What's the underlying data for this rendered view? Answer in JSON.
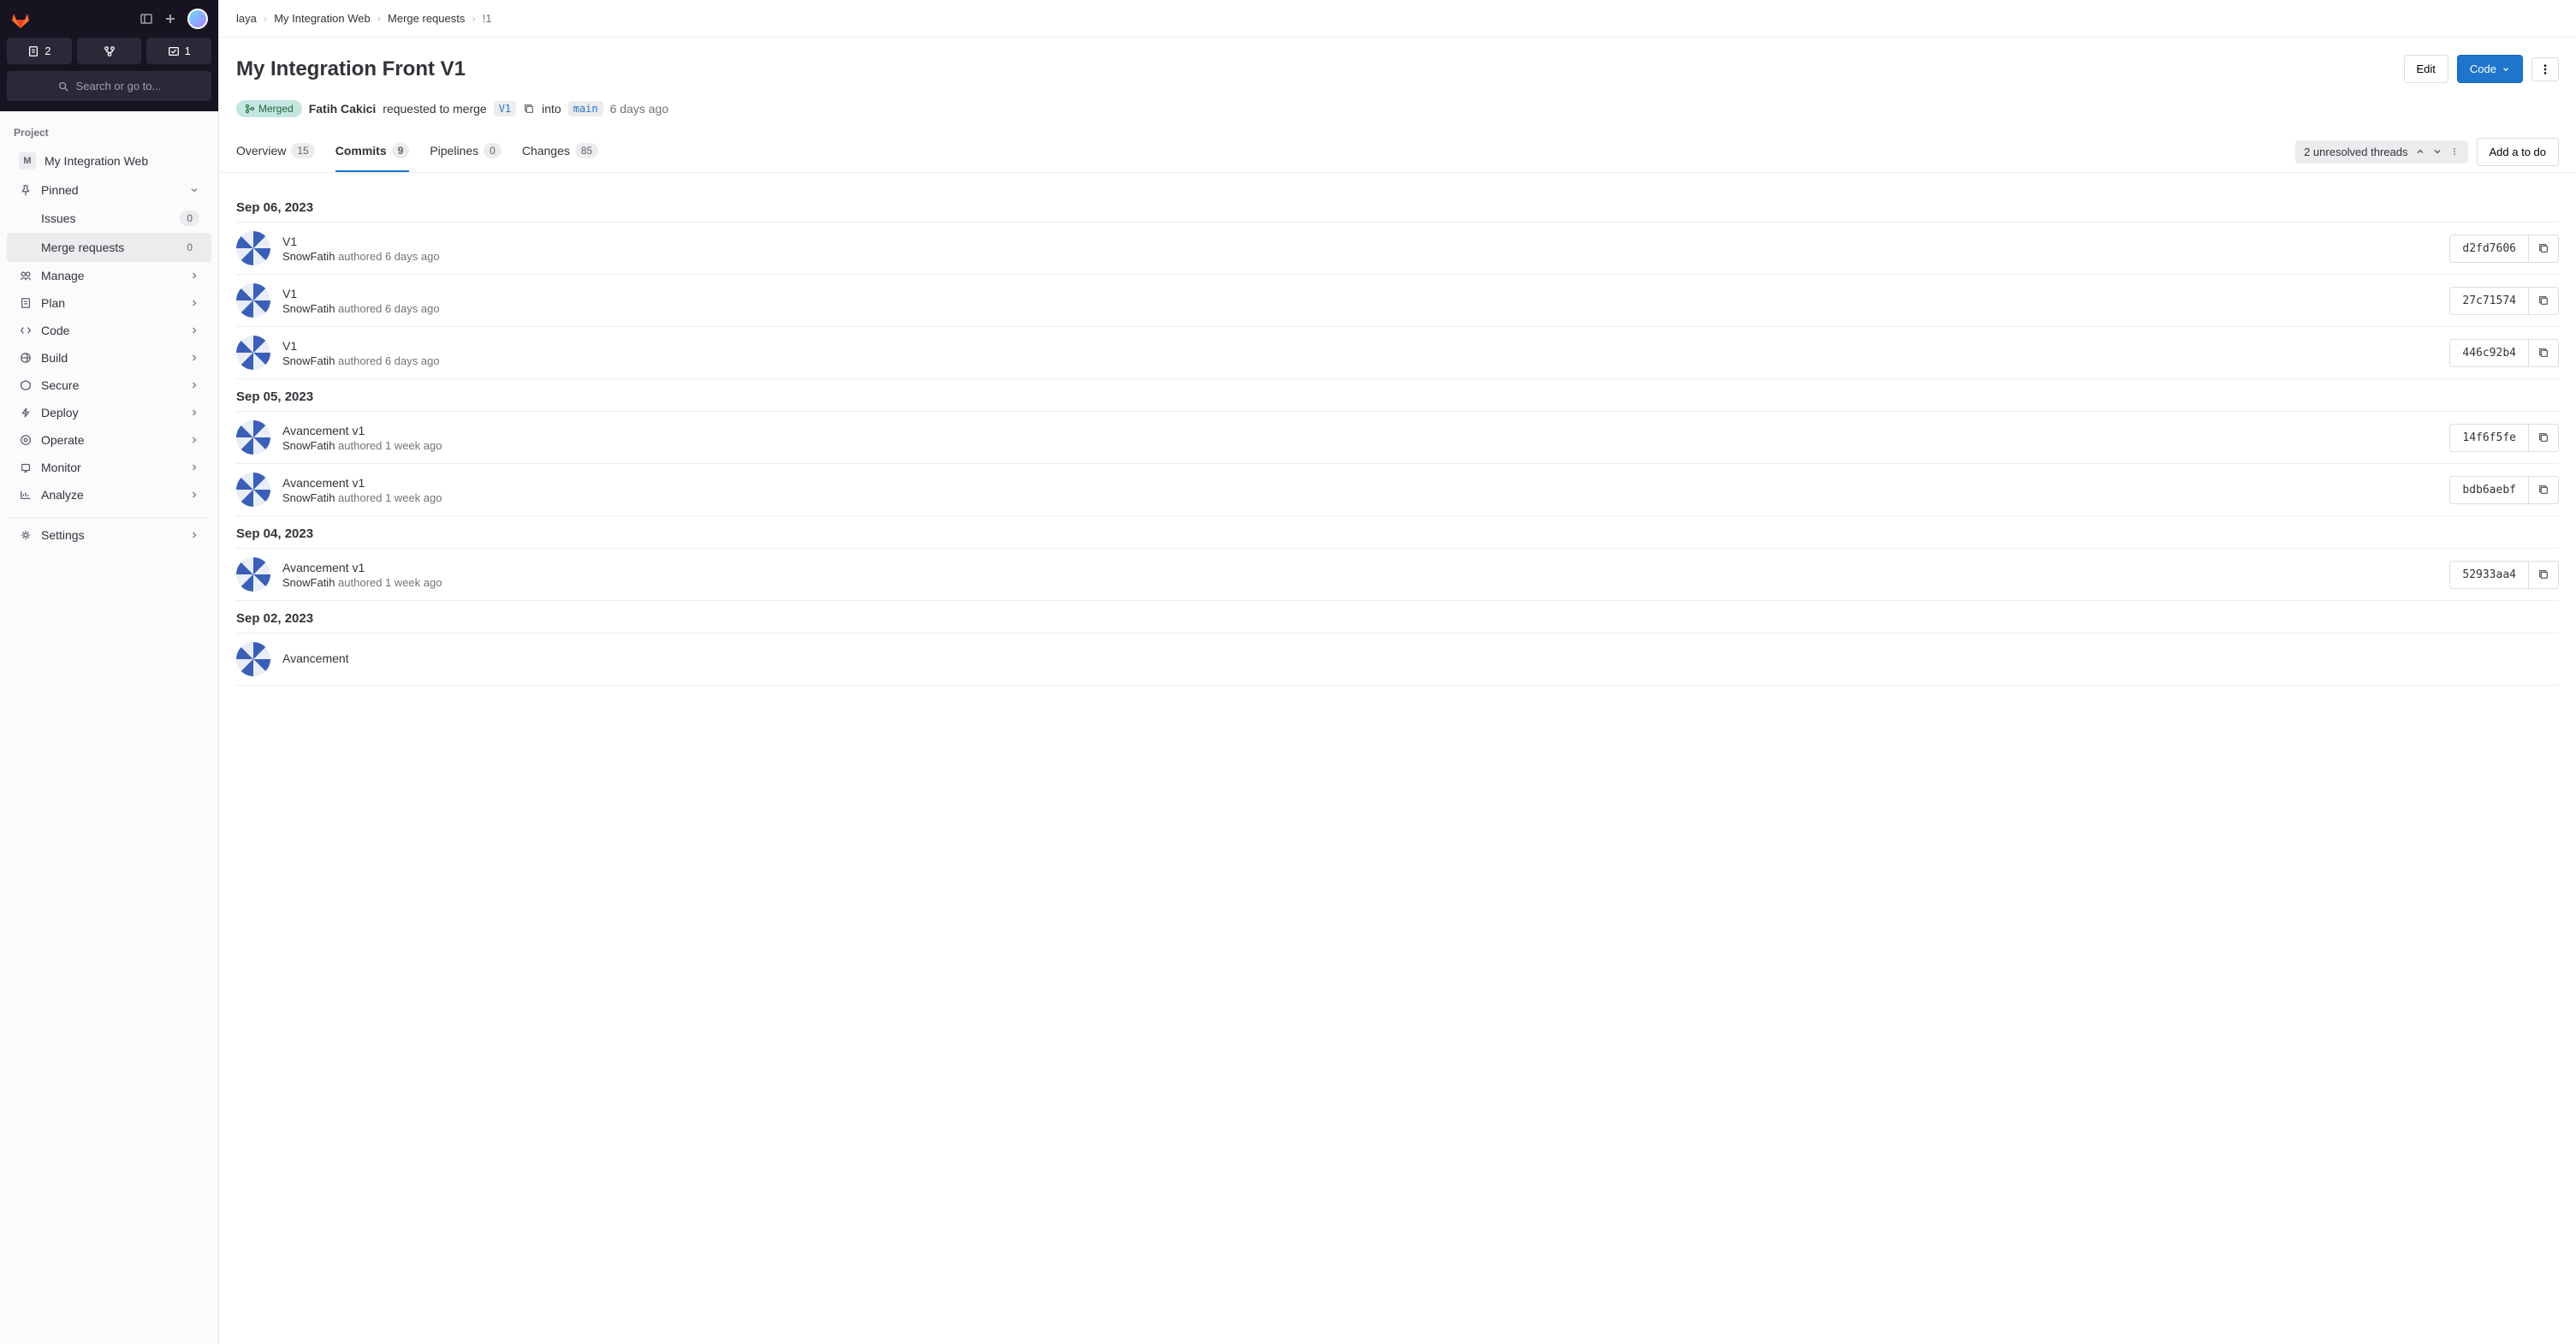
{
  "sidebar": {
    "toolbar": {
      "todos": "2",
      "mrs": "",
      "issues": "1"
    },
    "search_label": "Search or go to...",
    "section_label": "Project",
    "project": {
      "letter": "M",
      "name": "My Integration Web"
    },
    "pinned_label": "Pinned",
    "pinned_items": [
      {
        "label": "Issues",
        "badge": "0"
      },
      {
        "label": "Merge requests",
        "badge": "0"
      }
    ],
    "nav": [
      {
        "label": "Manage"
      },
      {
        "label": "Plan"
      },
      {
        "label": "Code"
      },
      {
        "label": "Build"
      },
      {
        "label": "Secure"
      },
      {
        "label": "Deploy"
      },
      {
        "label": "Operate"
      },
      {
        "label": "Monitor"
      },
      {
        "label": "Analyze"
      }
    ],
    "settings_label": "Settings"
  },
  "breadcrumbs": {
    "items": [
      "laya",
      "My Integration Web",
      "Merge requests",
      "!1"
    ]
  },
  "header": {
    "title": "My Integration Front V1",
    "edit_label": "Edit",
    "code_label": "Code"
  },
  "status": {
    "badge": "Merged",
    "author": "Fatih Cakici",
    "requested": "requested to merge",
    "source_branch": "V1",
    "into": "into",
    "target_branch": "main",
    "time": "6 days ago"
  },
  "tabs": {
    "items": [
      {
        "label": "Overview",
        "badge": "15"
      },
      {
        "label": "Commits",
        "badge": "9"
      },
      {
        "label": "Pipelines",
        "badge": "0"
      },
      {
        "label": "Changes",
        "badge": "85"
      }
    ],
    "threads_label": "2 unresolved threads",
    "add_todo_label": "Add a to do"
  },
  "commit_groups": [
    {
      "date": "Sep 06, 2023",
      "commits": [
        {
          "title": "V1",
          "author": "SnowFatih",
          "authored": "authored",
          "time": "6 days ago",
          "sha": "d2fd7606"
        },
        {
          "title": "V1",
          "author": "SnowFatih",
          "authored": "authored",
          "time": "6 days ago",
          "sha": "27c71574"
        },
        {
          "title": "V1",
          "author": "SnowFatih",
          "authored": "authored",
          "time": "6 days ago",
          "sha": "446c92b4"
        }
      ]
    },
    {
      "date": "Sep 05, 2023",
      "commits": [
        {
          "title": "Avancement v1",
          "author": "SnowFatih",
          "authored": "authored",
          "time": "1 week ago",
          "sha": "14f6f5fe"
        },
        {
          "title": "Avancement v1",
          "author": "SnowFatih",
          "authored": "authored",
          "time": "1 week ago",
          "sha": "bdb6aebf"
        }
      ]
    },
    {
      "date": "Sep 04, 2023",
      "commits": [
        {
          "title": "Avancement v1",
          "author": "SnowFatih",
          "authored": "authored",
          "time": "1 week ago",
          "sha": "52933aa4"
        }
      ]
    },
    {
      "date": "Sep 02, 2023",
      "commits": [
        {
          "title": "Avancement",
          "author": "",
          "authored": "",
          "time": "",
          "sha": ""
        }
      ]
    }
  ]
}
